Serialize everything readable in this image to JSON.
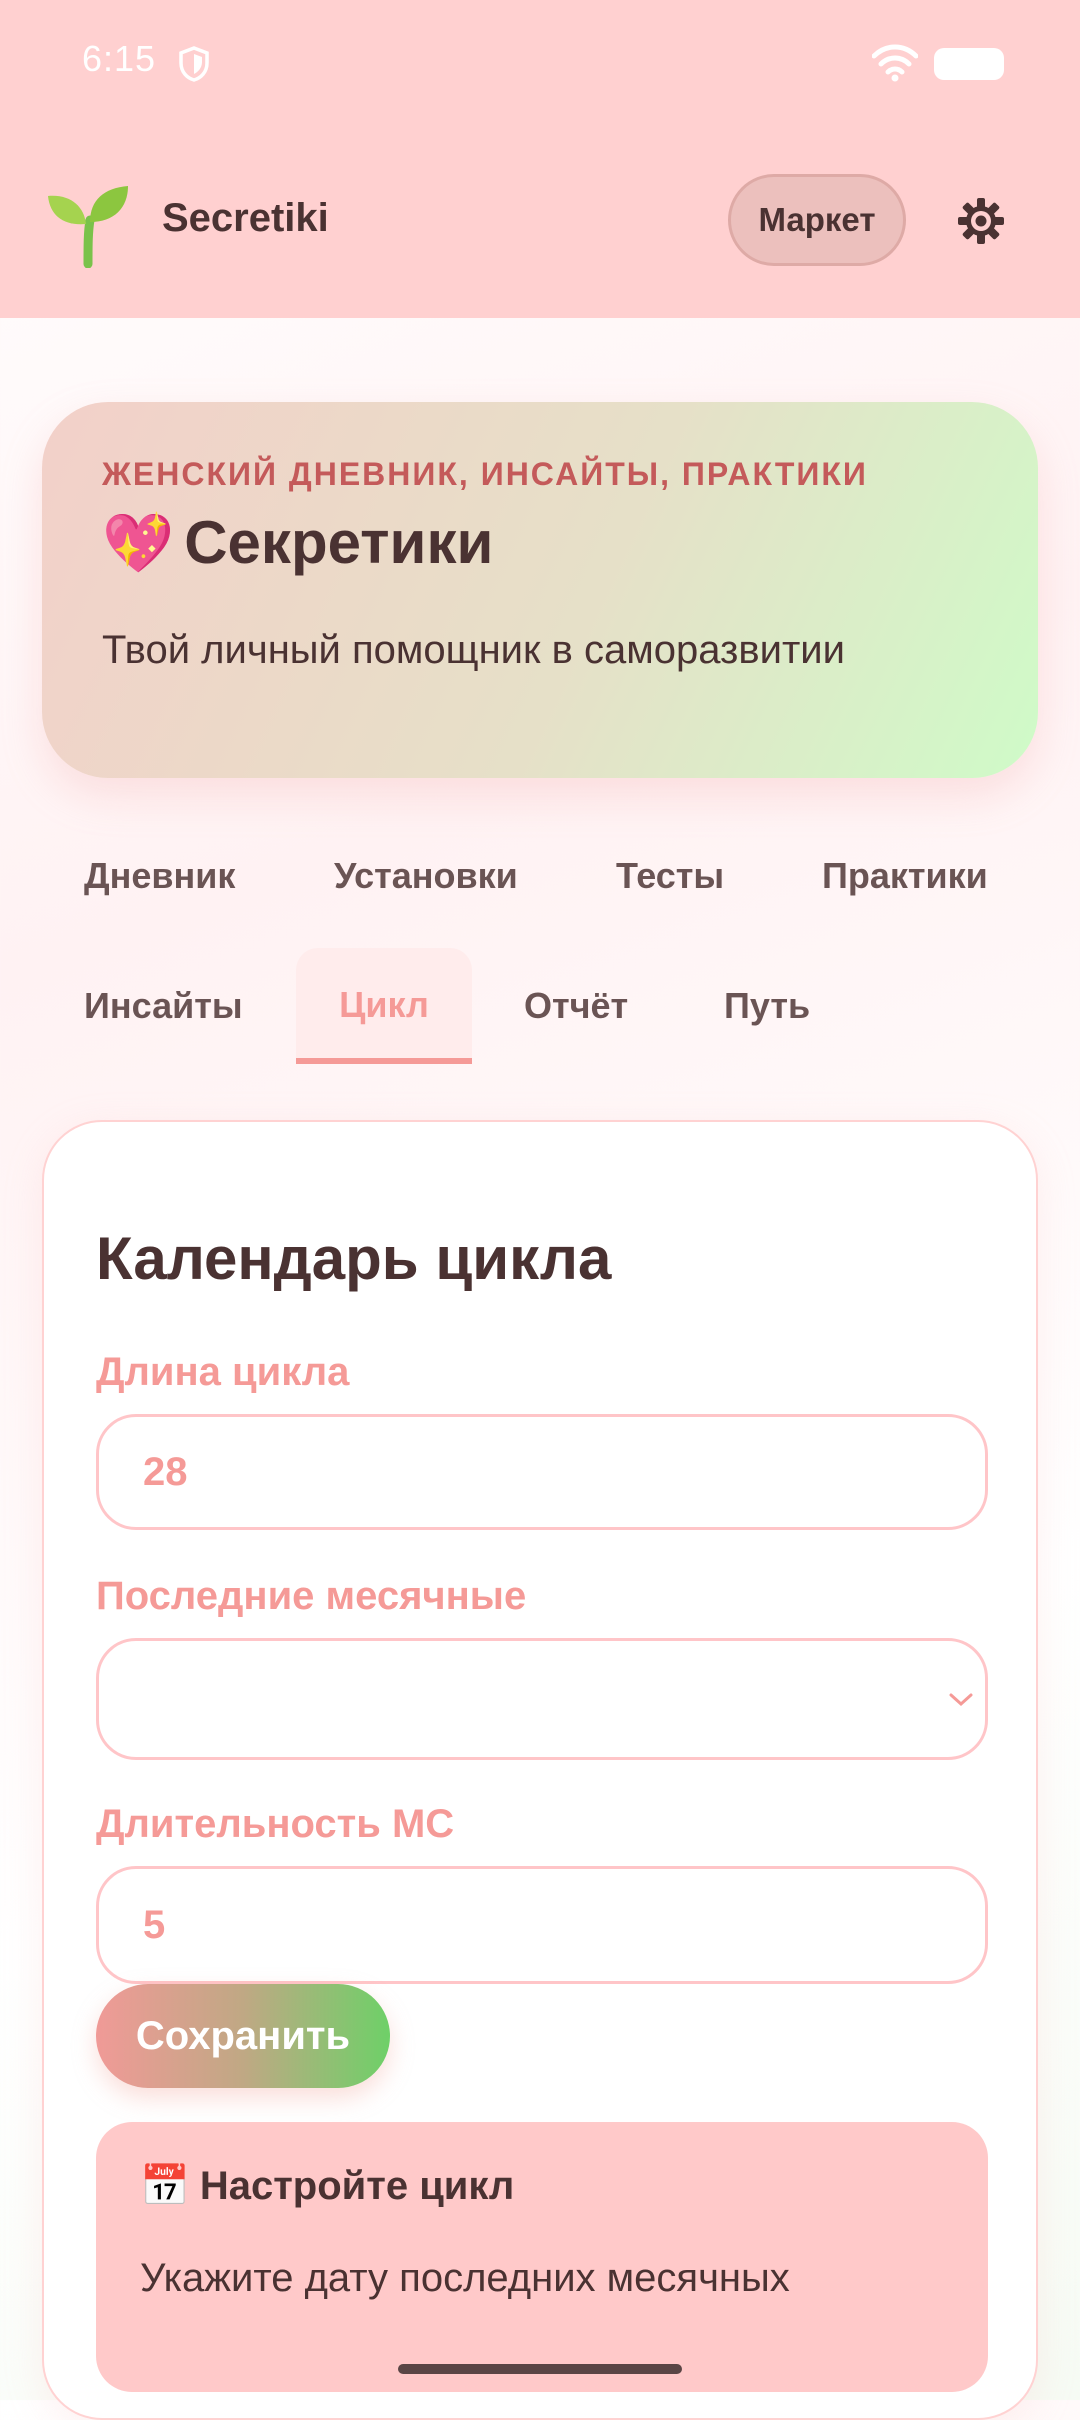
{
  "status_bar": {
    "time": "6:15"
  },
  "header": {
    "app_name": "Secretiki",
    "market_label": "Маркет"
  },
  "hero": {
    "kicker": "ЖЕНСКИЙ ДНЕВНИК, ИНСАЙТЫ, ПРАКТИКИ",
    "emoji": "💖",
    "title": "Секретики",
    "subtitle": "Твой личный помощник в саморазвитии"
  },
  "tabs": [
    {
      "label": "Дневник",
      "active": false
    },
    {
      "label": "Установки",
      "active": false
    },
    {
      "label": "Тесты",
      "active": false
    },
    {
      "label": "Практики",
      "active": false
    },
    {
      "label": "Инсайты",
      "active": false
    },
    {
      "label": "Цикл",
      "active": true
    },
    {
      "label": "Отчёт",
      "active": false
    },
    {
      "label": "Путь",
      "active": false
    }
  ],
  "cycle": {
    "title": "Календарь цикла",
    "length_label": "Длина цикла",
    "length_value": "28",
    "last_period_label": "Последние месячные",
    "last_period_value": "",
    "duration_label": "Длительность МС",
    "duration_value": "5",
    "save_label": "Сохранить",
    "notice_emoji": "📅",
    "notice_title": "Настройте цикл",
    "notice_text": "Укажите дату последних месячных"
  },
  "colors": {
    "header_bg": "#ffd0d0",
    "accent": "#f59a97",
    "text": "#4a3232",
    "notice_bg": "#ffc9c9"
  },
  "icons": [
    "shield-icon",
    "wifi-icon",
    "battery-icon",
    "sprout-logo-icon",
    "gear-icon",
    "chevron-down-icon"
  ]
}
